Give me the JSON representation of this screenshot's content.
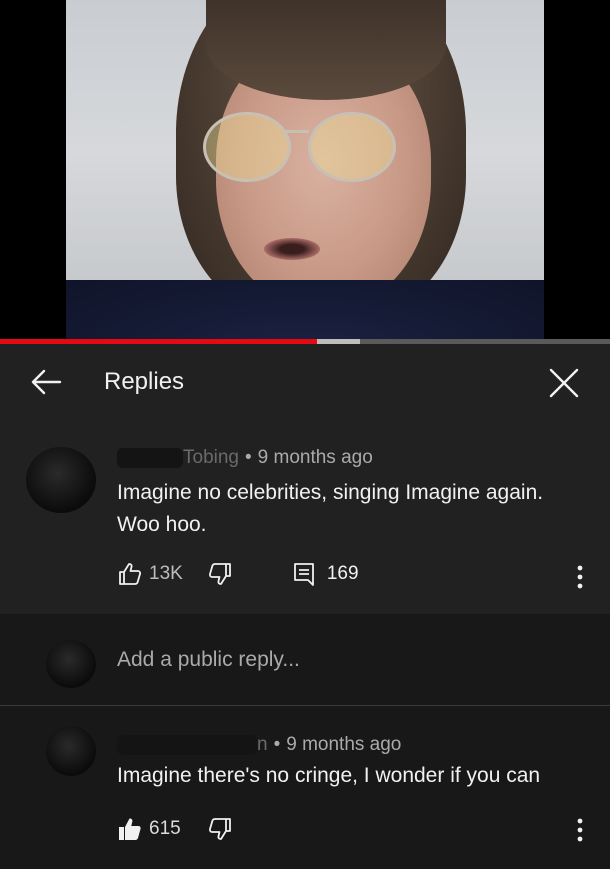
{
  "video": {
    "progress_fraction": 0.52,
    "buffered_fraction": 0.59,
    "accent_color": "#e50914"
  },
  "header": {
    "back_icon": "arrow-left-icon",
    "title": "Replies",
    "close_icon": "close-icon"
  },
  "parent_comment": {
    "author": "Tobing",
    "time": "9 months ago",
    "text": "Imagine no celebrities, singing Imagine again. Woo hoo.",
    "likes": "13K",
    "replies": "169"
  },
  "reply_input": {
    "placeholder": "Add a public reply..."
  },
  "replies": [
    {
      "author": "n",
      "time": "9 months ago",
      "text": "Imagine there's no cringe, I wonder if you can",
      "likes": "615",
      "liked": true
    }
  ]
}
